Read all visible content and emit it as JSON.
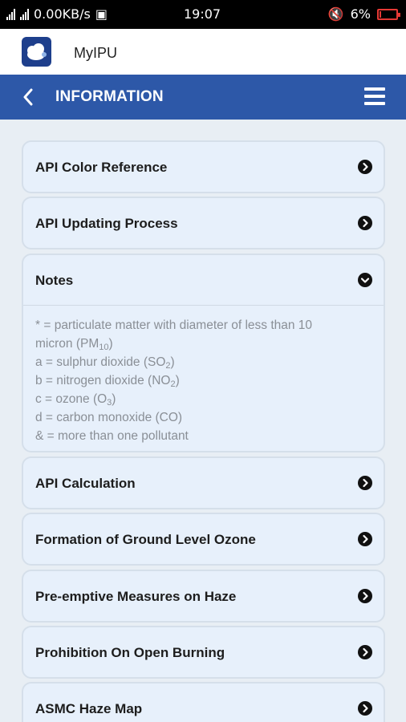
{
  "status": {
    "network_speed": "0.00KB/s",
    "time": "19:07",
    "battery": "6%",
    "battery_fraction": 0.06,
    "colors": {
      "battery": "#e53935"
    }
  },
  "app": {
    "name": "MyIPU"
  },
  "header": {
    "title": "INFORMATION"
  },
  "icons": {
    "back": "chevron-left-icon",
    "menu": "hamburger-menu-icon",
    "expand": "chevron-right-circle-icon",
    "collapse": "chevron-down-circle-icon"
  },
  "colors": {
    "header": "#2d58a8",
    "card": "#e7f0fb",
    "note_text": "#8a8f96"
  },
  "sections": [
    {
      "label": "API Color Reference",
      "expanded": false
    },
    {
      "label": "API Updating Process",
      "expanded": false
    },
    {
      "label": "Notes",
      "expanded": true
    },
    {
      "label": "API Calculation",
      "expanded": false
    },
    {
      "label": "Formation of Ground Level Ozone",
      "expanded": false
    },
    {
      "label": "Pre-emptive Measures on Haze",
      "expanded": false
    },
    {
      "label": "Prohibition On Open Burning",
      "expanded": false
    },
    {
      "label": "ASMC Haze Map",
      "expanded": false
    }
  ],
  "notes": {
    "line1": "* = particulate matter with diameter of less than 10",
    "line2_text": "micron (PM",
    "line2_sub": "10",
    "line2_end": ")",
    "line3_text": "a = sulphur dioxide (SO",
    "line3_sub": "2",
    "line3_end": ")",
    "line4_text": "b = nitrogen dioxide (NO",
    "line4_sub": "2",
    "line4_end": ")",
    "line5_text": "c = ozone (O",
    "line5_sub": "3",
    "line5_end": ")",
    "line6": "d = carbon monoxide (CO)",
    "line7": "& = more than one pollutant"
  }
}
